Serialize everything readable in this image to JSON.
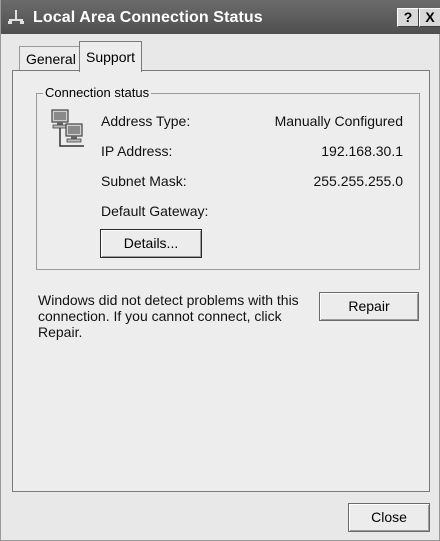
{
  "window": {
    "title": "Local Area Connection Status"
  },
  "title_buttons": {
    "help": "?",
    "close": "X"
  },
  "tabs": [
    {
      "label": "General",
      "active": false
    },
    {
      "label": "Support",
      "active": true
    }
  ],
  "connection_status": {
    "group_label": "Connection status",
    "rows": [
      {
        "label": "Address Type:",
        "value": "Manually Configured"
      },
      {
        "label": "IP Address:",
        "value": "192.168.30.1"
      },
      {
        "label": "Subnet Mask:",
        "value": "255.255.255.0"
      },
      {
        "label": "Default Gateway:",
        "value": ""
      }
    ],
    "details_button": "Details..."
  },
  "repair": {
    "message": "Windows did not detect problems with this connection. If you cannot connect, click Repair.",
    "button": "Repair"
  },
  "footer": {
    "close_button": "Close"
  },
  "icons": {
    "title": "network-connection-icon",
    "status": "network-computers-icon"
  }
}
